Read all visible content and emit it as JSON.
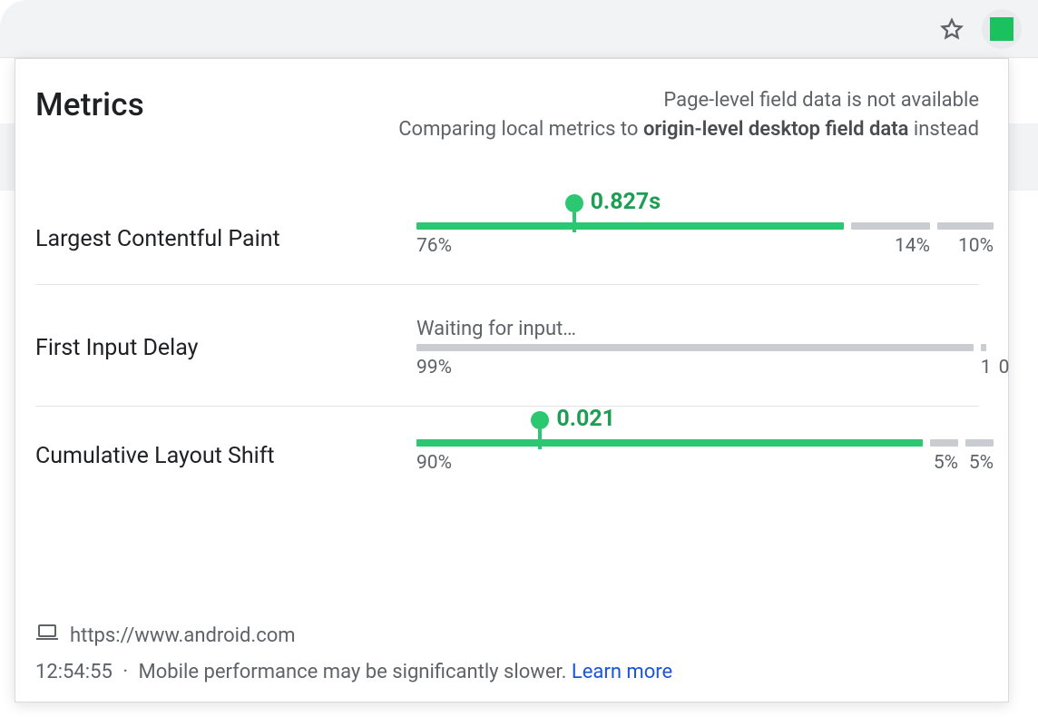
{
  "header": {
    "title": "Metrics",
    "note_line1": "Page-level field data is not available",
    "note_line2a": "Comparing local metrics to ",
    "note_line2b_bold": "origin-level desktop field data",
    "note_line2c": " instead"
  },
  "metrics": {
    "lcp": {
      "label": "Largest Contentful Paint",
      "value": "0.827s",
      "marker_pct": 28,
      "segments": [
        {
          "pct": "76%",
          "kind": "good"
        },
        {
          "pct": "14%",
          "kind": "grey"
        },
        {
          "pct": "10%",
          "kind": "grey"
        }
      ]
    },
    "fid": {
      "label": "First Input Delay",
      "waiting": "Waiting for input…",
      "segments": [
        {
          "pct": "99%",
          "kind": "grey"
        },
        {
          "pct": "1",
          "kind": "grey"
        },
        {
          "pct": "0",
          "kind": "grey"
        }
      ]
    },
    "cls": {
      "label": "Cumulative Layout Shift",
      "value": "0.021",
      "marker_pct": 22,
      "segments": [
        {
          "pct": "90%",
          "kind": "good"
        },
        {
          "pct": "5%",
          "kind": "grey"
        },
        {
          "pct": "5%",
          "kind": "grey"
        }
      ]
    }
  },
  "footer": {
    "url": "https://www.android.com",
    "timestamp": "12:54:55",
    "warning": "Mobile performance may be significantly slower.",
    "learn_more": "Learn more"
  }
}
